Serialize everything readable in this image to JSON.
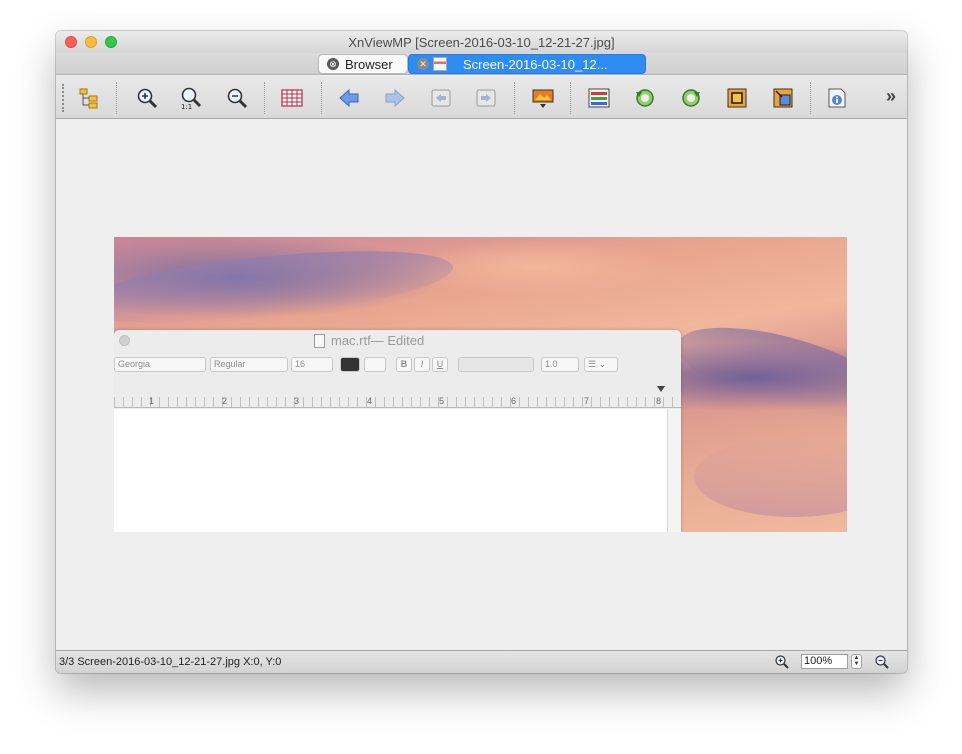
{
  "window": {
    "title": "XnViewMP [Screen-2016-03-10_12-21-27.jpg]"
  },
  "tabs": [
    {
      "label": "Browser",
      "close": "⊗"
    },
    {
      "label": "Screen-2016-03-10_12...",
      "close": "✕"
    }
  ],
  "toolbar": {
    "icons": [
      "folder-tree-icon",
      "zoom-in-icon",
      "zoom-1to1-icon",
      "zoom-out-icon",
      "grid-icon",
      "back-arrow-icon",
      "forward-arrow-icon",
      "previous-image-icon",
      "next-image-icon",
      "slideshow-icon",
      "adjust-icon",
      "rotate-left-icon",
      "rotate-right-icon",
      "crop-icon",
      "resize-icon",
      "info-icon"
    ],
    "more_label": "»"
  },
  "document": {
    "filename": "mac.rtf",
    "edited": " — Edited",
    "font_family": "Georgia",
    "font_style": "Regular",
    "font_size": "16",
    "bold": "B",
    "italic": "I",
    "underline": "U",
    "line_spacing": "1.0",
    "ruler_numbers": [
      "1",
      "2",
      "3",
      "4",
      "5",
      "6",
      "7",
      "8"
    ]
  },
  "status": {
    "text": "3/3   Screen-2016-03-10_12-21-27.jpg   X:0, Y:0",
    "zoom": "100%"
  },
  "colors": {
    "tab_active": "#2f8cf3",
    "close": "#fc605b",
    "minimize": "#fdbc40",
    "maximize": "#34c84a"
  }
}
